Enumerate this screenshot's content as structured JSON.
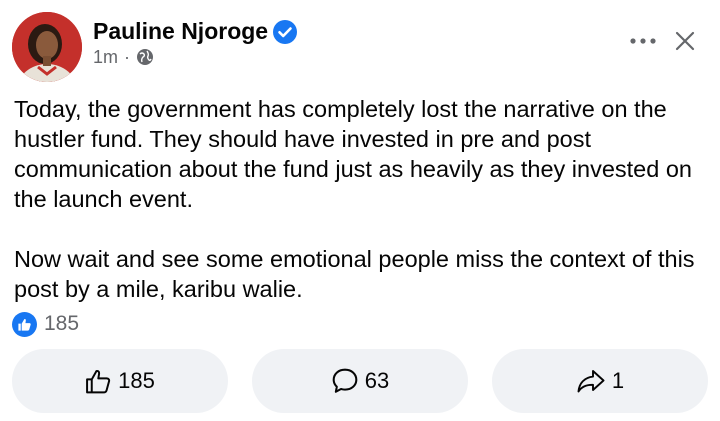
{
  "post": {
    "author_name": "Pauline Njoroge",
    "timestamp": "1m",
    "separator": "·",
    "paragraphs": [
      "Today, the government has completely lost the narrative on the hustler fund. They should have invested in pre and post communication about the fund just as heavily as they invested on the launch event.",
      "Now wait and see some emotional people miss the context of this post by a mile, karibu walie."
    ]
  },
  "reactions": {
    "count": "185",
    "icon": "like-icon"
  },
  "actions": {
    "like_count": "185",
    "comment_count": "63",
    "share_count": "1"
  },
  "colors": {
    "accent": "#1877f2",
    "button_bg": "#f0f2f5",
    "secondary_text": "#65676b"
  }
}
